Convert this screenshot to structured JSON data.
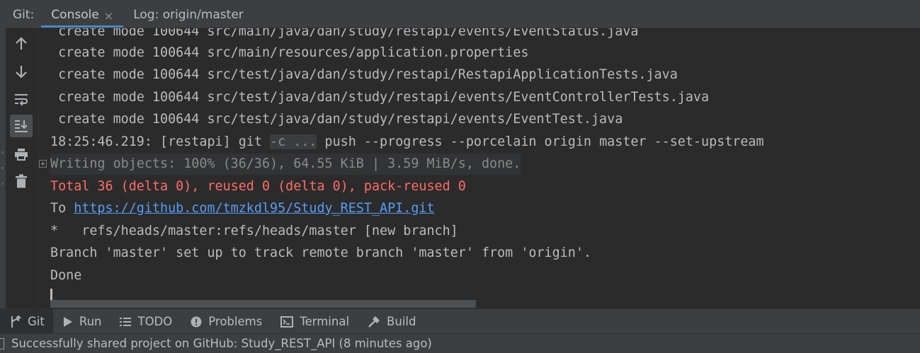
{
  "tabbar": {
    "title": "Git:",
    "tabs": [
      {
        "label": "Console",
        "active": true,
        "closable": true
      },
      {
        "label": "Log: origin/master",
        "active": false,
        "closable": false
      }
    ],
    "close_glyph": "×"
  },
  "side_toolbar": {
    "buttons": [
      {
        "icon": "arrow-up-icon",
        "tooltip": "Up"
      },
      {
        "icon": "arrow-down-icon",
        "tooltip": "Down"
      },
      {
        "icon": "soft-wrap-icon",
        "tooltip": "Soft-wrap"
      },
      {
        "icon": "scroll-to-end-icon",
        "tooltip": "Scroll to end",
        "pressed": true
      },
      {
        "icon": "print-icon",
        "tooltip": "Print"
      },
      {
        "icon": "trash-icon",
        "tooltip": "Clear all"
      }
    ]
  },
  "console": {
    "lines": [
      {
        "text": " create mode 100644 src/main/java/dan/study/restapi/events/EventStatus.java",
        "style": "normal"
      },
      {
        "text": " create mode 100644 src/main/resources/application.properties",
        "style": "normal"
      },
      {
        "text": " create mode 100644 src/test/java/dan/study/restapi/RestapiApplicationTests.java",
        "style": "normal"
      },
      {
        "text": " create mode 100644 src/test/java/dan/study/restapi/events/EventControllerTests.java",
        "style": "normal"
      },
      {
        "text": " create mode 100644 src/test/java/dan/study/restapi/events/EventTest.java",
        "style": "normal"
      }
    ],
    "command": {
      "prefix": "18:25:46.219: [restapi] git ",
      "collapsed": "-c ...",
      "suffix": " push --progress --porcelain origin master --set-upstream"
    },
    "progress_line": "Writing objects: 100% (36/36), 64.55 KiB | 3.59 MiB/s, done.",
    "error_line": "Total 36 (delta 0), reused 0 (delta 0), pack-reused 0",
    "to_prefix": "To ",
    "remote_url": "https://github.com/tmzkdl95/Study_REST_API.git",
    "ref_line": "*   refs/heads/master:refs/heads/master [new branch]",
    "branch_line": "Branch 'master' set up to track remote branch 'master' from 'origin'.",
    "done_line": "Done"
  },
  "bottom_toolbar": {
    "items": [
      {
        "label": "Git",
        "icon": "git-branch-icon",
        "active": true
      },
      {
        "label": "Run",
        "icon": "run-icon",
        "active": false
      },
      {
        "label": "TODO",
        "icon": "todo-list-icon",
        "active": false
      },
      {
        "label": "Problems",
        "icon": "problems-icon",
        "active": false
      },
      {
        "label": "Terminal",
        "icon": "terminal-icon",
        "active": false
      },
      {
        "label": "Build",
        "icon": "build-hammer-icon",
        "active": false
      }
    ]
  },
  "status_bar": {
    "message": "Successfully shared project on GitHub: Study_REST_API (8 minutes ago)"
  },
  "colors": {
    "background": "#2b2b2b",
    "panel": "#3c3f41",
    "text": "#bbbbbb",
    "error": "#ff6b68",
    "link": "#589df6",
    "accent_tab": "#4a88c7"
  }
}
